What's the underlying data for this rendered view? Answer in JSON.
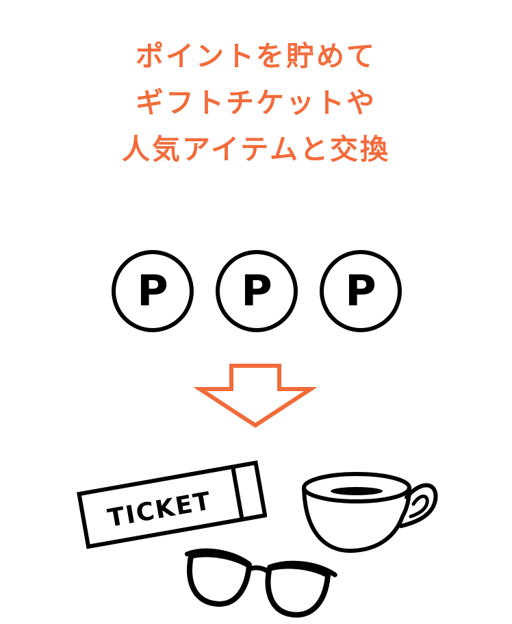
{
  "headline": {
    "line1": "ポイントを貯めて",
    "line2": "ギフトチケットや",
    "line3": "人気アイテムと交換",
    "color": "#f26b3a"
  },
  "points": {
    "coins": [
      "P",
      "P",
      "P"
    ],
    "stroke_color": "#000000"
  },
  "arrow": {
    "icon": "down-arrow-outline-icon",
    "color": "#f26b3a"
  },
  "items": {
    "ticket": {
      "icon": "ticket-icon",
      "label": "TICKET"
    },
    "cup": {
      "icon": "coffee-cup-icon"
    },
    "glasses": {
      "icon": "eyeglasses-icon"
    }
  }
}
